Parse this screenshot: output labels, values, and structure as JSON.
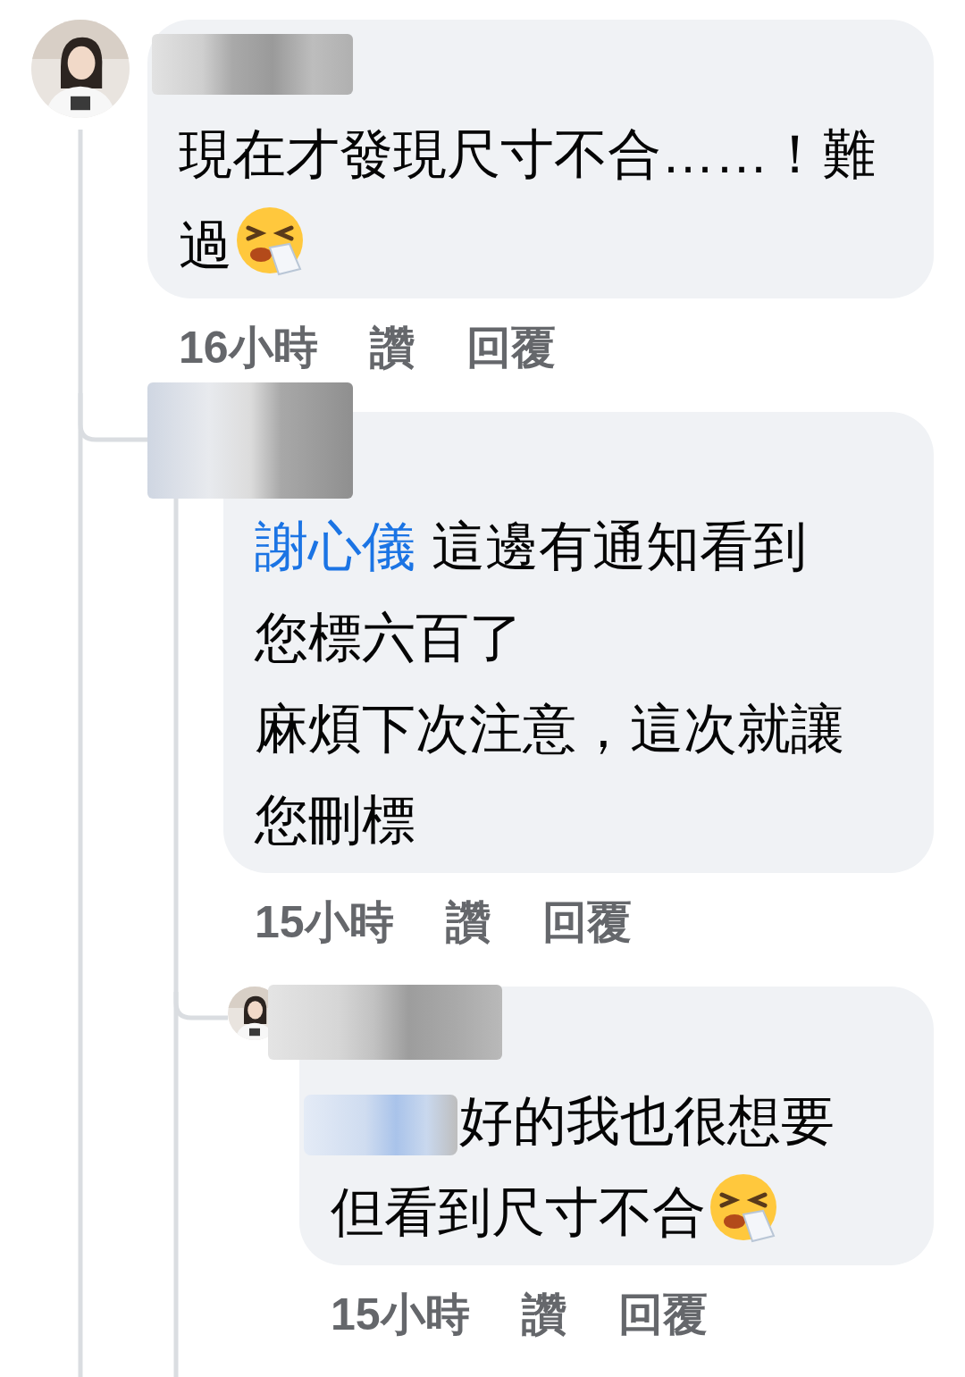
{
  "comments": [
    {
      "avatar": {
        "kind": "picture"
      },
      "lines": [
        "現在才發現尺寸不合……！難",
        "過"
      ],
      "ends_with_emoji": true,
      "time": "16小時",
      "like": "讚",
      "reply": "回覆",
      "children": [
        {
          "mention": "謝心儀",
          "lines": [
            "這邊有通知看到",
            "您標六百了",
            "麻煩下次注意，這次就讓",
            "您刪標"
          ],
          "ends_with_emoji": false,
          "time": "15小時",
          "like": "讚",
          "reply": "回覆",
          "children": [
            {
              "avatar": {
                "kind": "picture"
              },
              "mention_redacted": true,
              "lines": [
                "好的我也很想要",
                "但看到尺寸不合"
              ],
              "ends_with_emoji": true,
              "time": "15小時",
              "like": "讚",
              "reply": "回覆"
            }
          ]
        }
      ]
    }
  ]
}
